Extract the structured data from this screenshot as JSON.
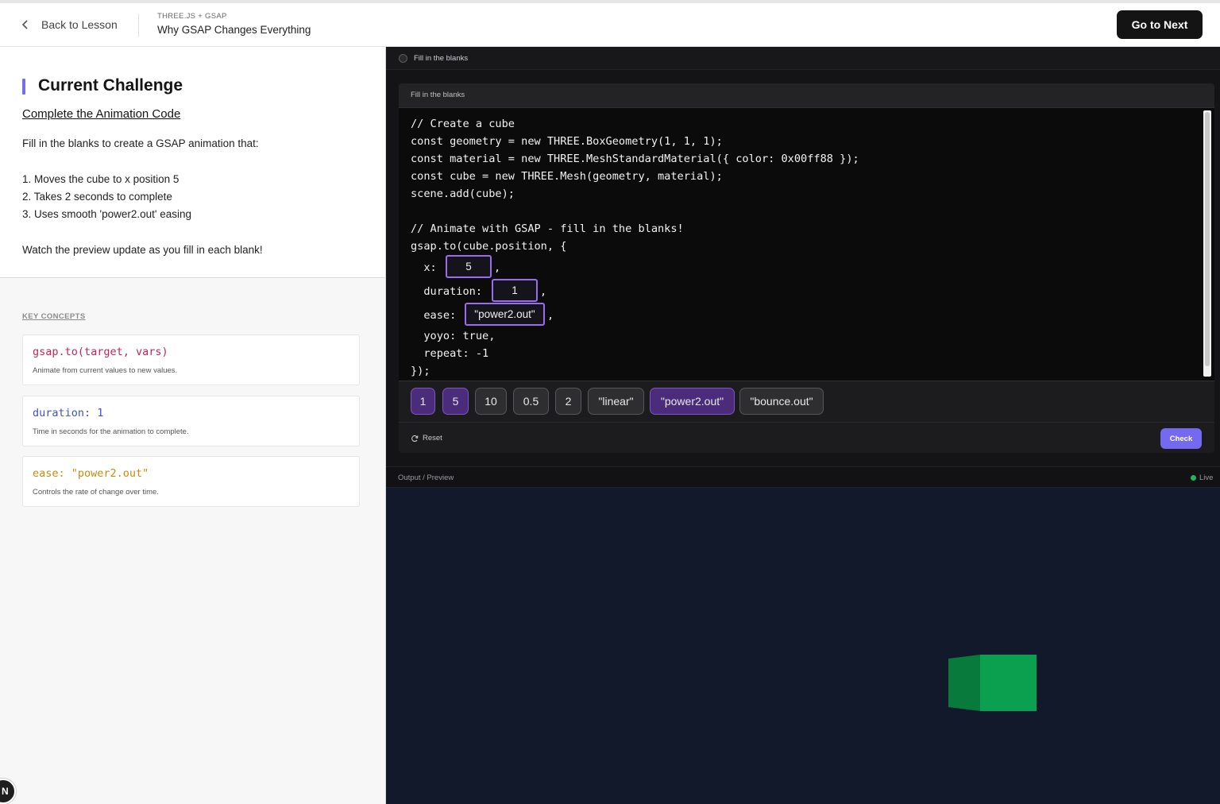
{
  "header": {
    "back_label": "Back to Lesson",
    "course": "THREE.JS + GSAP",
    "lesson_title": "Why GSAP Changes Everything",
    "next_label": "Go to Next"
  },
  "challenge": {
    "heading": "Current Challenge",
    "subtitle": "Complete the Animation Code",
    "intro": "Fill in the blanks to create a GSAP animation that:",
    "steps": [
      "1. Moves the cube to x position 5",
      "2. Takes 2 seconds to complete",
      "3. Uses smooth 'power2.out' easing"
    ],
    "footer": "Watch the preview update as you fill in each blank!"
  },
  "concepts": {
    "label": "KEY CONCEPTS",
    "items": [
      {
        "code": "gsap.to(target, vars)",
        "desc": "Animate from current values to new values.",
        "color": "#c0245c"
      },
      {
        "code": "duration: 1",
        "desc": "Time in seconds for the animation to complete.",
        "color": "#3c52c9"
      },
      {
        "code": "ease: \"power2.out\"",
        "desc": "Controls the rate of change over time.",
        "color": "#c98a0e"
      }
    ]
  },
  "editor": {
    "tab_label": "Fill in the blanks",
    "panel_label": "Fill in the blanks",
    "code_lines": [
      "// Create a cube",
      "const geometry = new THREE.BoxGeometry(1, 1, 1);",
      "const material = new THREE.MeshStandardMaterial({ color: 0x00ff88 });",
      "const cube = new THREE.Mesh(geometry, material);",
      "scene.add(cube);",
      "",
      "// Animate with GSAP - fill in the blanks!",
      "gsap.to(cube.position, {"
    ],
    "blank_lines": {
      "x_prefix": "  x:",
      "duration_prefix": "  duration:",
      "ease_prefix": "  ease:",
      "comma": ","
    },
    "blanks": {
      "x": "5",
      "duration": "1",
      "ease": "\"power2.out\""
    },
    "tail_lines": [
      "  yoyo: true,",
      "  repeat: -1",
      "});"
    ],
    "tokens": [
      {
        "label": "1",
        "used": true
      },
      {
        "label": "5",
        "used": true
      },
      {
        "label": "10",
        "used": false
      },
      {
        "label": "0.5",
        "used": false
      },
      {
        "label": "2",
        "used": false
      },
      {
        "label": "\"linear\"",
        "used": false
      },
      {
        "label": "\"power2.out\"",
        "used": true
      },
      {
        "label": "\"bounce.out\"",
        "used": false
      }
    ],
    "reset_label": "Reset",
    "check_label": "Check"
  },
  "output": {
    "label": "Output / Preview",
    "status": "Live",
    "cube_color": "#0aa050"
  }
}
